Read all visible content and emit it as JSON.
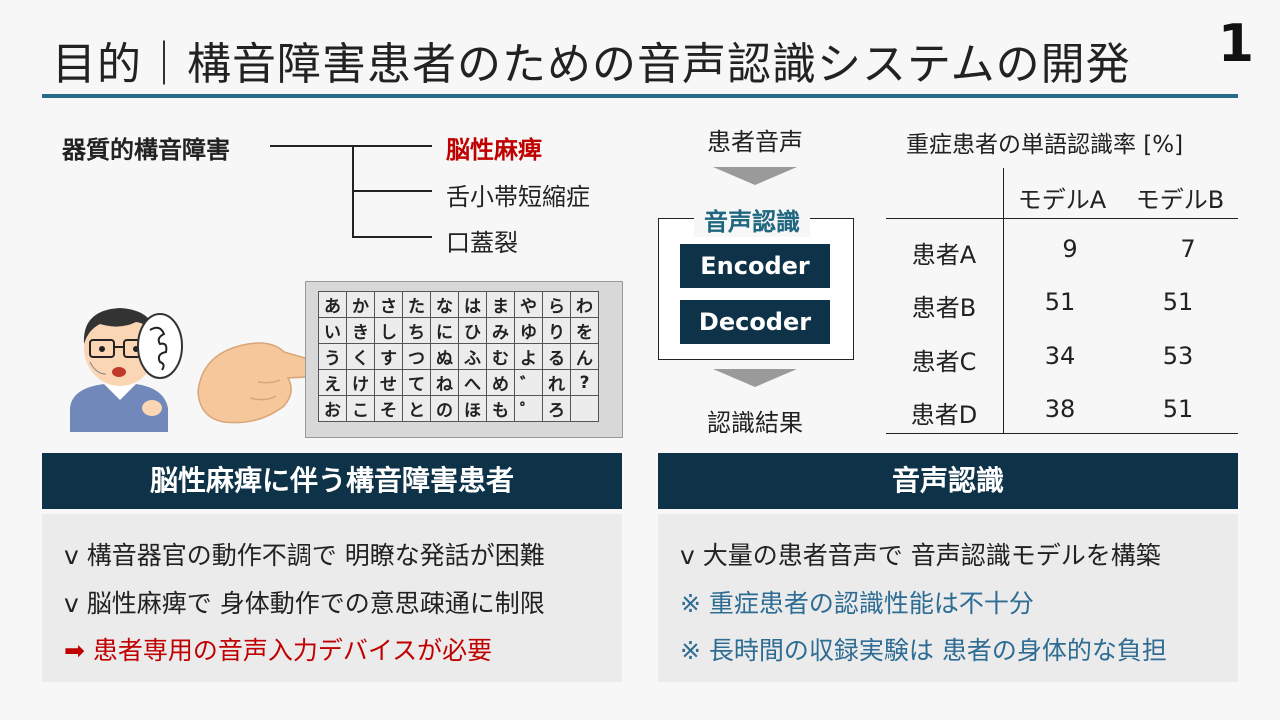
{
  "header": {
    "title": "目的｜構音障害患者のための音声認識システムの開発",
    "page_number": "1"
  },
  "tree": {
    "root": "器質的構音障害",
    "leaves": [
      "脳性麻痺",
      "舌小帯短縮症",
      "口蓋裂"
    ]
  },
  "speech_bubble": "?",
  "kana_board": {
    "rows": [
      [
        "あ",
        "か",
        "さ",
        "た",
        "な",
        "は",
        "ま",
        "や",
        "ら",
        "わ"
      ],
      [
        "い",
        "き",
        "し",
        "ち",
        "に",
        "ひ",
        "み",
        "ゆ",
        "り",
        "を"
      ],
      [
        "う",
        "く",
        "す",
        "つ",
        "ぬ",
        "ふ",
        "む",
        "よ",
        "る",
        "ん"
      ],
      [
        "え",
        "け",
        "せ",
        "て",
        "ね",
        "へ",
        "め",
        "゛",
        "れ",
        "?"
      ],
      [
        "お",
        "こ",
        "そ",
        "と",
        "の",
        "ほ",
        "も",
        "゜",
        "ろ",
        ""
      ]
    ]
  },
  "left_panel": {
    "heading": "脳性麻痺に伴う構音障害患者",
    "bullets": [
      "v  構音器官の動作不調で 明瞭な発話が困難",
      "v  脳性麻痺で 身体動作での意思疎通に制限",
      "➡ 患者専用の音声入力デバイスが必要"
    ]
  },
  "flow": {
    "input": "患者音声",
    "caption": "音声認識",
    "encoder": "Encoder",
    "decoder": "Decoder",
    "output": "認識結果"
  },
  "results": {
    "caption": "重症患者の単語認識率 [%]",
    "columns": [
      "モデルA",
      "モデルB"
    ],
    "rows": [
      {
        "patient": "患者A",
        "a": "9",
        "b": "7"
      },
      {
        "patient": "患者B",
        "a": "51",
        "b": "51"
      },
      {
        "patient": "患者C",
        "a": "34",
        "b": "53"
      },
      {
        "patient": "患者D",
        "a": "38",
        "b": "51"
      }
    ]
  },
  "right_panel": {
    "heading": "音声認識",
    "bullets": [
      "v  大量の患者音声で 音声認識モデルを構築",
      "※ 重症患者の認識性能は不十分",
      "※ 長時間の収録実験は 患者の身体的な負担"
    ]
  },
  "colors": {
    "accent": "#2a6b88",
    "dark_header": "#0e3348",
    "highlight_red": "#c00000",
    "note_blue": "#2e6c94",
    "panel_bg": "#ebebeb"
  },
  "icons": [
    "patient-illustration",
    "pointing-hand-illustration",
    "speech-bubble-icon",
    "down-arrow-icon"
  ]
}
